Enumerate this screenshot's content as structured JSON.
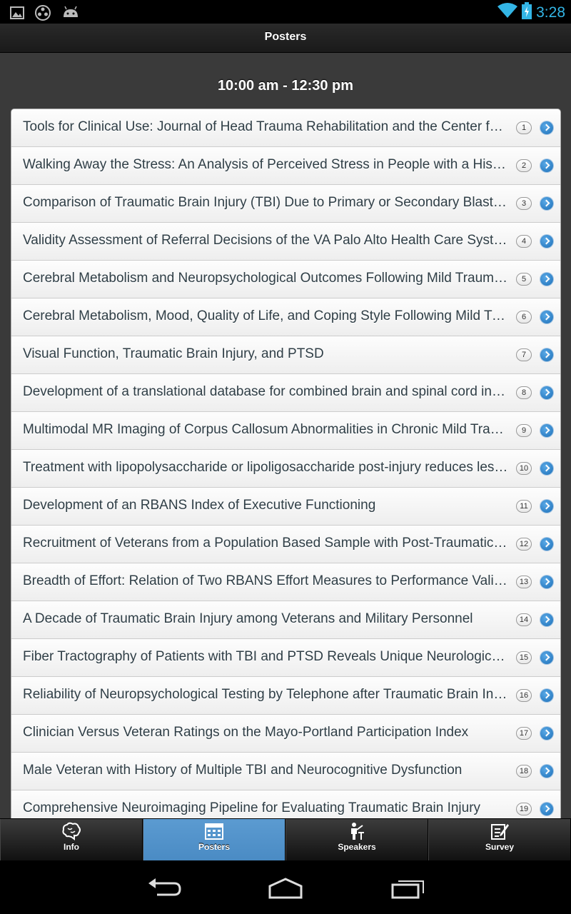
{
  "status_bar": {
    "time": "3:28",
    "icons": [
      "image-icon",
      "media-icon",
      "android-icon",
      "wifi-icon",
      "battery-charging-icon"
    ]
  },
  "header": {
    "title": "Posters"
  },
  "session": {
    "title": "10:00 am - 12:30 pm"
  },
  "posters": [
    {
      "title": "Tools for Clinical Use: Journal of Head Trauma Rehabilitation and the Center for Outcome Measurement in Brain Injury",
      "number": "1"
    },
    {
      "title": "Walking Away the Stress: An Analysis of Perceived Stress in People with a History of Traumatic Brain Injury",
      "number": "2"
    },
    {
      "title": "Comparison of Traumatic Brain Injury (TBI) Due to Primary or Secondary Blast Exposure",
      "number": "3"
    },
    {
      "title": "Validity Assessment of Referral Decisions of the VA Palo Alto Health Care System",
      "number": "4"
    },
    {
      "title": "Cerebral Metabolism and Neuropsychological Outcomes Following Mild Traumatic Brain Injury",
      "number": "5"
    },
    {
      "title": "Cerebral Metabolism, Mood, Quality of Life, and Coping Style Following Mild Traumatic Brain Injury",
      "number": "6"
    },
    {
      "title": "Visual Function, Traumatic Brain Injury, and PTSD",
      "number": "7"
    },
    {
      "title": "Development of a translational database for combined brain and spinal cord injury",
      "number": "8"
    },
    {
      "title": "Multimodal MR Imaging of Corpus Callosum Abnormalities in Chronic Mild Traumatic Brain Injury",
      "number": "9"
    },
    {
      "title": "Treatment with lipopolysaccharide or lipoligosaccharide post-injury reduces lesion volume",
      "number": "10"
    },
    {
      "title": "Development of an RBANS Index of Executive Functioning",
      "number": "11"
    },
    {
      "title": "Recruitment of Veterans from a Population Based Sample with Post-Traumatic Stress Disorder",
      "number": "12"
    },
    {
      "title": "Breadth of Effort: Relation of Two RBANS Effort Measures to Performance Validity",
      "number": "13"
    },
    {
      "title": "A Decade of Traumatic Brain Injury among Veterans and Military Personnel",
      "number": "14"
    },
    {
      "title": "Fiber Tractography of Patients with TBI and PTSD Reveals Unique Neurological Patterns",
      "number": "15"
    },
    {
      "title": "Reliability of Neuropsychological Testing by Telephone after Traumatic Brain Injury",
      "number": "16"
    },
    {
      "title": "Clinician Versus Veteran Ratings on the Mayo-Portland Participation Index",
      "number": "17"
    },
    {
      "title": "Male Veteran with History of Multiple TBI and Neurocognitive Dysfunction",
      "number": "18"
    },
    {
      "title": "Comprehensive Neuroimaging Pipeline for Evaluating Traumatic Brain Injury",
      "number": "19"
    }
  ],
  "tabs": [
    {
      "label": "Info",
      "icon": "brain-icon"
    },
    {
      "label": "Posters",
      "icon": "calendar-icon"
    },
    {
      "label": "Speakers",
      "icon": "speaker-icon"
    },
    {
      "label": "Survey",
      "icon": "survey-icon"
    }
  ],
  "active_tab": "Posters",
  "colors": {
    "accent": "#4a8bc4",
    "status_time": "#33b5e5"
  }
}
